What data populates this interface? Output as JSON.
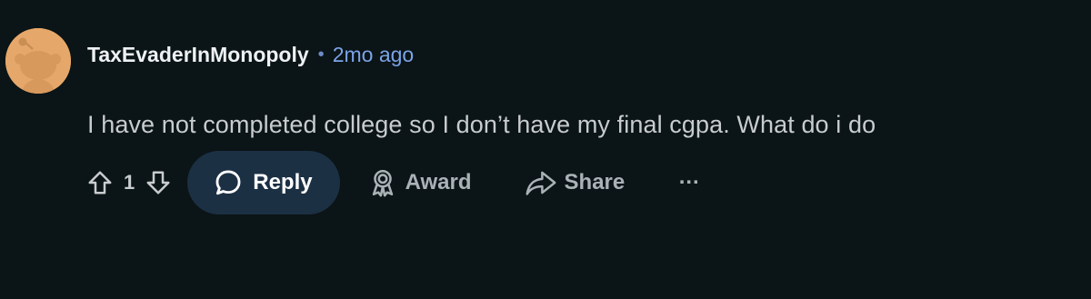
{
  "comment": {
    "author": "TaxEvaderInMonopoly",
    "separator": "•",
    "time_ago": "2mo ago",
    "text": "I have not completed college so I don’t have my final cgpa. What do i do",
    "avatar_icon": "snoo-avatar-icon"
  },
  "actions": {
    "upvote_icon": "arrow-up-icon",
    "vote_count": "1",
    "downvote_icon": "arrow-down-icon",
    "reply_label": "Reply",
    "reply_icon": "speech-bubble-icon",
    "award_label": "Award",
    "award_icon": "award-ribbon-icon",
    "share_label": "Share",
    "share_icon": "share-arrow-icon",
    "more_label": "..."
  },
  "colors": {
    "background": "#0b1416",
    "time_accent": "#7ba4e8",
    "reply_button_bg": "#1c3044",
    "avatar_bg": "#e6a86a"
  }
}
